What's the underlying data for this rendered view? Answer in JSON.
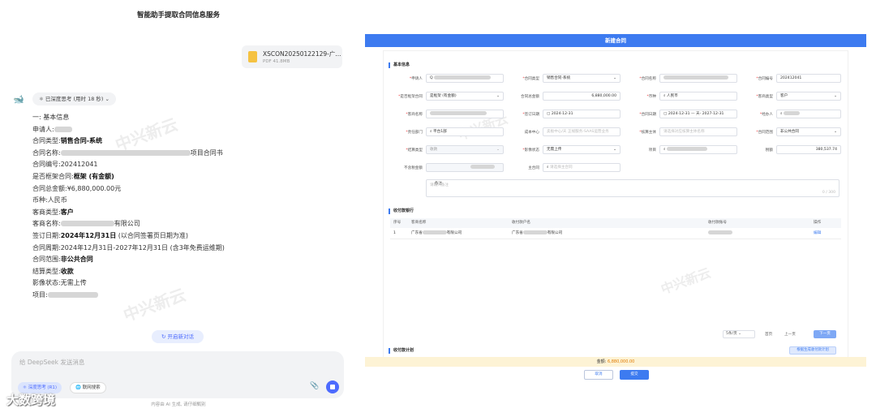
{
  "chat": {
    "title": "智能助手提取合同信息服务",
    "file": {
      "name": "XSCON20250122129-广...",
      "size": "PDF 41.8MB"
    },
    "think_label": "已深度思考 (用时 18 秒)",
    "answer": {
      "heading": "一: 基本信息",
      "applicant_label": "申请人:",
      "contract_type_label": "合同类型:",
      "contract_type_value": "销售合同-系统",
      "contract_name_label": "合同名称:",
      "contract_name_suffix": "项目合同书",
      "contract_no_label": "合同编号:",
      "contract_no_value": "202412041",
      "framework_label": "是否框架合同:",
      "framework_value": "框架 (有金额)",
      "amount_label": "合同总金额:",
      "amount_value": "¥6,880,000.00元",
      "currency_label": "币种:",
      "currency_value": "人民币",
      "client_type_label": "客商类型:",
      "client_type_value": "客户",
      "client_name_label": "客商名称:",
      "client_name_suffix": "有限公司",
      "sign_date_label": "签订日期:",
      "sign_date_value": "2024年12月31日",
      "sign_date_note": "(以合同签署页日期为准)",
      "period_label": "合同周期:",
      "period_value": "2024年12月31日-2027年12月31日 (含3年免费运维期)",
      "scope_label": "合同范围:",
      "scope_value": "非公共合同",
      "settle_label": "结算类型:",
      "settle_value": "收款",
      "image_label": "影像状态:",
      "image_value": "无需上传",
      "project_label": "项目:"
    },
    "new_chat": "开启新对话",
    "input_placeholder": "给 DeepSeek 发送消息",
    "deep_think": "深度思考 (R1)",
    "web_search": "联网搜索",
    "footer": "内容由 AI 生成, 请仔细甄别"
  },
  "brand": "大数跨境",
  "watermark": "中兴新云",
  "form": {
    "title": "新建合同",
    "section_basic": "基本信息",
    "fields": {
      "applicant": "申请人",
      "applicant_val": "Q",
      "contract_type": "合同类型",
      "contract_type_val": "销售合同-系统",
      "contract_name": "合同名称",
      "contract_no": "合同编号",
      "contract_no_val": "202412041",
      "framework": "是否框架合同",
      "framework_val": "是框架 (有金额)",
      "total_amount": "合同总金额",
      "total_amount_val": "6,880,000.00",
      "currency": "币种",
      "currency_val": "人民币",
      "client_type": "客商类型",
      "client_type_val": "客户",
      "client_name": "客商名称",
      "sign_date": "签订日期",
      "sign_date_val": "2024-12-31",
      "period": "合同日期",
      "period_val": "2024-12-31 — 天- 2027-12-31",
      "handler": "经办人",
      "dept": "责任部门",
      "dept_val": "平台1部",
      "cost_center": "成本中心",
      "cost_center_ph": "卖板中心/天 正规服务-SAAS运营业务",
      "subject": "核算主体",
      "subject_ph": "请选择对应核算主体名称",
      "scope": "合同范围",
      "scope_val": "非公共合同",
      "settle": "结算类型",
      "settle_val": "收款",
      "image_state": "影像状态",
      "image_state_val": "无需上传",
      "project": "项目",
      "tax": "税额",
      "tax_val": "380,537.74",
      "excl_tax": "不含税金额",
      "main_contract": "主合同",
      "main_contract_ph": "请选择主合同",
      "remark": "备注",
      "remark_ph": "请输入备注",
      "remark_count": "0 / 300"
    },
    "section_payer": "收付款银行",
    "table": {
      "headers": [
        "序号",
        "客商名称",
        "收付款户名",
        "收付款账号",
        "操作"
      ],
      "rows": [
        {
          "no": "1",
          "client": "广东省",
          "client_suffix": "有限公司",
          "account_name": "广东省",
          "account_suffix": "有限公司",
          "action": "编辑"
        }
      ]
    },
    "pager": {
      "size": "5条/页",
      "prev_label": "首页",
      "prev": "上一页",
      "next": "下一页"
    },
    "section_plan": "收付款计划",
    "plan_button": "根据生成收付款计划",
    "total_label": "金额:",
    "total_value": "6,880,000.00",
    "cancel": "取消",
    "submit": "提交"
  }
}
